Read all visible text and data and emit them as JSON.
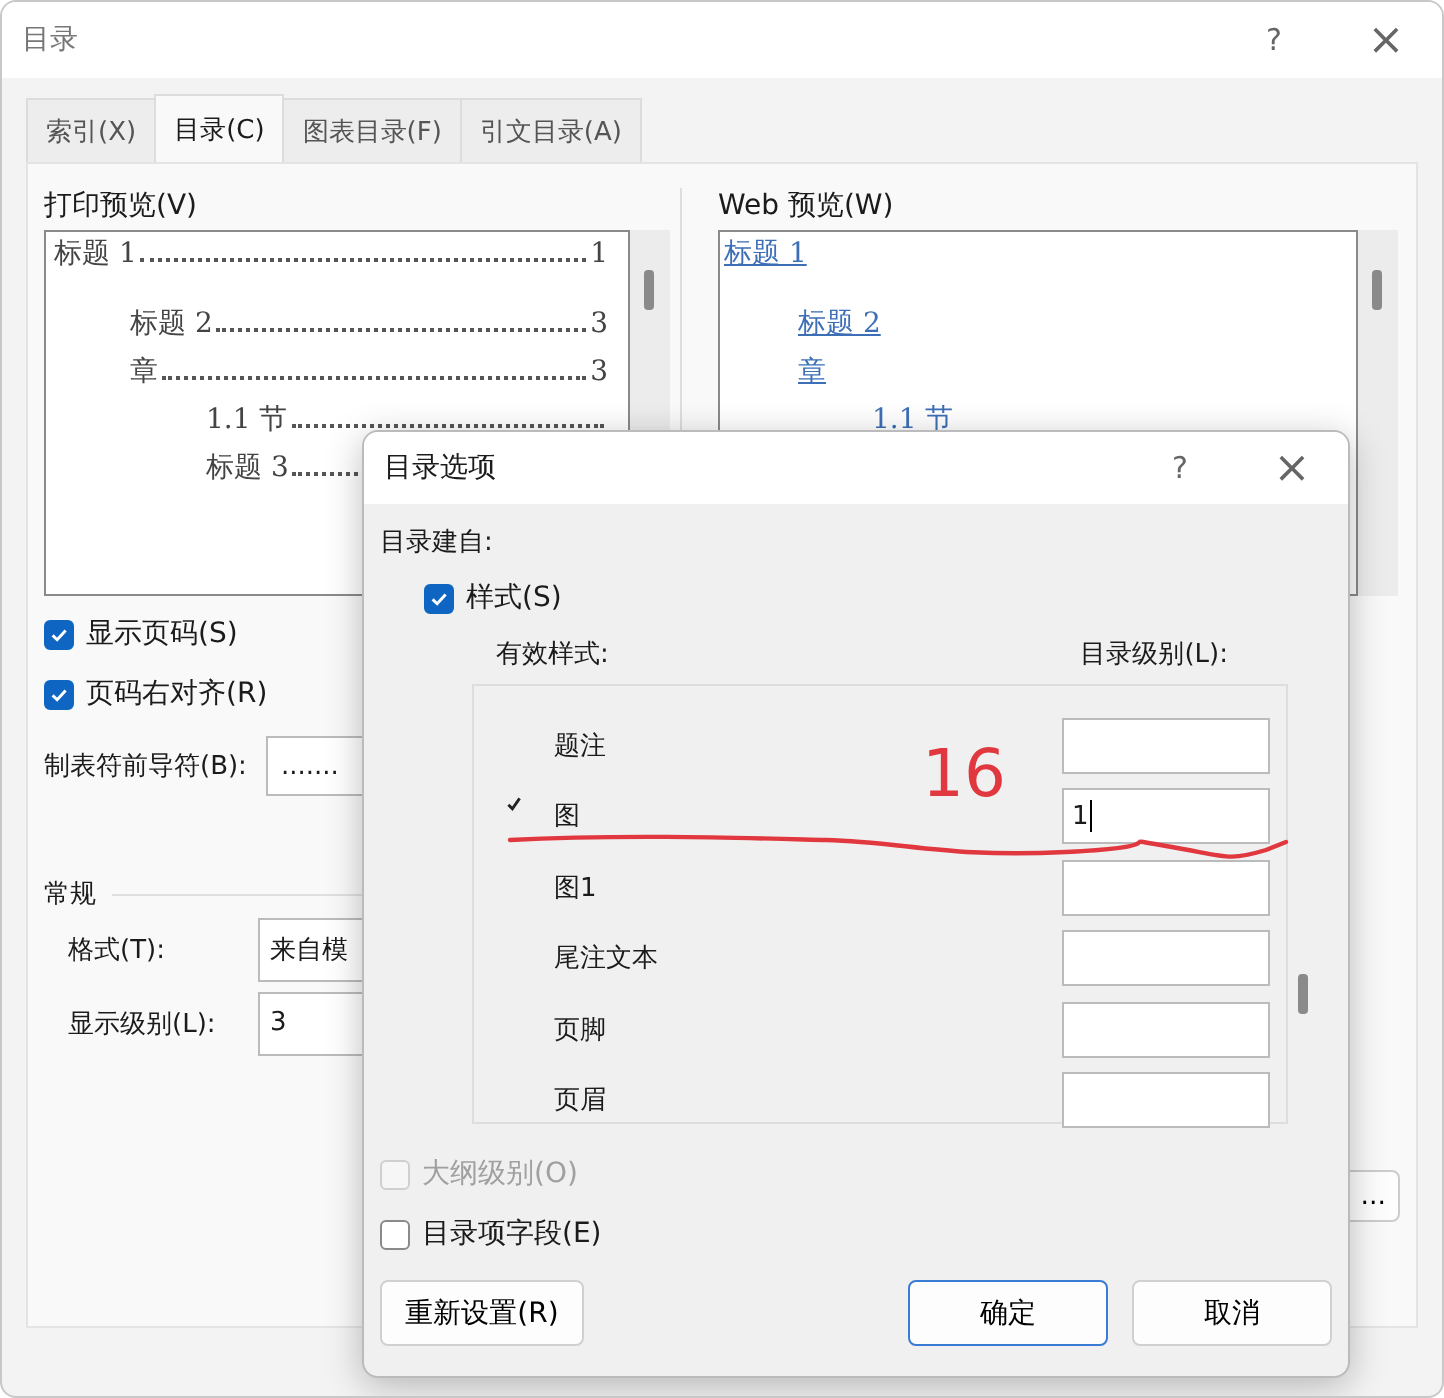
{
  "window": {
    "title": "目录",
    "help": "?",
    "close": "×"
  },
  "tabs": [
    {
      "label": "索引(X)",
      "selected": false
    },
    {
      "label": "目录(C)",
      "selected": true
    },
    {
      "label": "图表目录(F)",
      "selected": false
    },
    {
      "label": "引文目录(A)",
      "selected": false
    }
  ],
  "print_preview": {
    "label": "打印预览(V)",
    "entries": [
      {
        "text": "标题 1",
        "page": "1",
        "children": [
          {
            "text": "标题 2",
            "page": "3"
          },
          {
            "text": "章",
            "page": "3",
            "children": [
              {
                "text": "1.1 节"
              },
              {
                "text": "标题 3"
              }
            ]
          }
        ]
      }
    ]
  },
  "web_preview": {
    "label": "Web 预览(W)",
    "entries": [
      {
        "text": "标题 1",
        "children": [
          {
            "text": "标题 2"
          },
          {
            "text": "章",
            "children": [
              {
                "text": "1.1 节"
              }
            ]
          }
        ]
      }
    ]
  },
  "options": [
    {
      "label": "显示页码(S)",
      "checked": true
    },
    {
      "label": "页码右对齐(R)",
      "checked": true
    }
  ],
  "tab_leader": {
    "label": "制表符前导符(B):",
    "value": "......."
  },
  "general": {
    "title": "常规",
    "fields": [
      {
        "label": "格式(T):",
        "value": "来自模"
      },
      {
        "label": "显示级别(L):",
        "value": "3"
      }
    ]
  },
  "options_button": "...",
  "toc_options_dialog": {
    "title": "目录选项",
    "help": "?",
    "close": "×",
    "build_from": "目录建自:",
    "styles": {
      "label": "样式(S)",
      "checked": true
    },
    "columns": [
      "有效样式:",
      "目录级别(L):"
    ],
    "rows": [
      {
        "style": "题注",
        "in_use": false
      },
      {
        "style": "图",
        "in_use": true,
        "toc_level": "1"
      },
      {
        "style": "图1",
        "in_use": false
      },
      {
        "style": "尾注文本",
        "in_use": false
      },
      {
        "style": "页脚",
        "in_use": false
      },
      {
        "style": "页眉",
        "in_use": false
      }
    ],
    "checkboxes": [
      {
        "label": "大纲级别(O)",
        "checked": false,
        "disabled": true
      },
      {
        "label": "目录项字段(E)",
        "checked": false,
        "disabled": false
      }
    ],
    "buttons": [
      {
        "label": "重新设置(R)",
        "kind": "secondary"
      },
      {
        "label": "确定",
        "kind": "default"
      },
      {
        "label": "取消",
        "kind": "secondary"
      }
    ]
  },
  "annotation": {
    "text": "16"
  }
}
